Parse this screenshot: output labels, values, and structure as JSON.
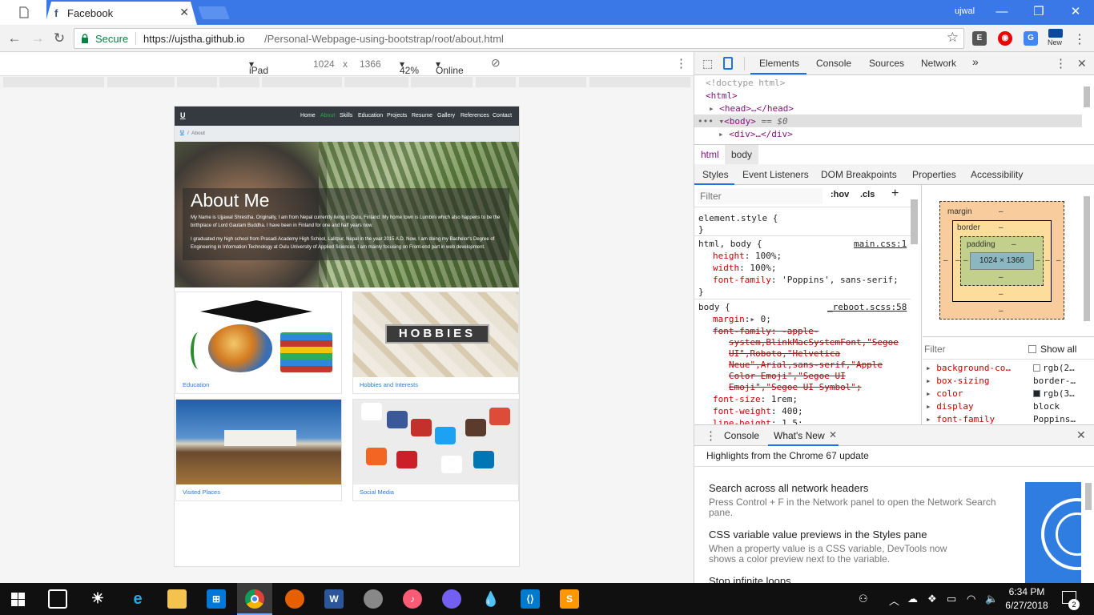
{
  "browser": {
    "tab_title": "Facebook",
    "user": "ujwal",
    "secure_label": "Secure",
    "url_host": "https://ujstha.github.io",
    "url_path": "/Personal-Webpage-using-bootstrap/root/about.html",
    "ext_new_label": "New"
  },
  "device_toolbar": {
    "device": "iPad Pro",
    "width": "1024",
    "times": "x",
    "height": "1366",
    "zoom": "42%",
    "network": "Online"
  },
  "site": {
    "brand": "U",
    "nav": [
      "Home",
      "About",
      "Skills",
      "Education",
      "Projects",
      "Resume",
      "Gallery",
      "References",
      "Contact"
    ],
    "active_nav": "About",
    "breadcrumb_home": "U",
    "breadcrumb_sep": "/",
    "breadcrumb_current": "About",
    "hero_title": "About Me",
    "hero_p1": "My Name is Ujjawal Shrestha. Originally, I am from Nepal currently living in Oulu, Finland. My home town is Lumbini which also happens to be the birthplace of Lord Gautam Buddha. I have been in Finland for one and half years now.",
    "hero_p2": "I graduated my high school from Prasadi Academy High School, Lalitpur, Nepal in the year 2015 A.D. Now, I am doing my Bachelor's Degree of Engineering in Information Technology at Oulu University of Applied Sciences. I am mainly focusing on Front-end part in web development.",
    "cards": [
      "Education",
      "Hobbies and Interests",
      "Visited Places",
      "Social Media"
    ],
    "hobbies_word": "HOBBIES"
  },
  "devtools": {
    "tabs": [
      "Elements",
      "Console",
      "Sources",
      "Network"
    ],
    "more_tabs": "»",
    "dom": {
      "doctype": "<!doctype html>",
      "html_open": "<html>",
      "head": "<head>…</head>",
      "body": "<body>",
      "body_eq": "== $0",
      "div": "<div>…</div>"
    },
    "path": [
      "html",
      "body"
    ],
    "subtabs": [
      "Styles",
      "Event Listeners",
      "DOM Breakpoints",
      "Properties",
      "Accessibility"
    ],
    "filter_placeholder": "Filter",
    "hov": ":hov",
    "cls": ".cls",
    "plus": "+",
    "rules": {
      "element_style": "element.style {",
      "close_brace": "}",
      "r1_selector": "html, body {",
      "r1_source": "main.css:1",
      "r1_props": [
        {
          "name": "height",
          "value": "100%;"
        },
        {
          "name": "width",
          "value": "100%;"
        },
        {
          "name": "font-family",
          "value": "'Poppins', sans-serif;"
        }
      ],
      "r2_selector": "body {",
      "r2_source": "_reboot.scss:58",
      "r2_margin_name": "margin",
      "r2_margin_value": "0;",
      "r2_struck": [
        "font-family: -apple-",
        "system,BlinkMacSystemFont,\"Segoe",
        "UI\",Roboto,\"Helvetica",
        "Neue\",Arial,sans-serif,\"Apple",
        "Color Emoji\",\"Segoe UI",
        "Emoji\",\"Segoe UI Symbol\";"
      ],
      "r2_props": [
        {
          "name": "font-size",
          "value": "1rem;"
        },
        {
          "name": "font-weight",
          "value": "400;"
        },
        {
          "name": "line-height",
          "value": "1.5;"
        }
      ]
    },
    "box_model": {
      "margin": "margin",
      "border": "border",
      "padding": "padding",
      "dash": "–",
      "content": "1024 × 1366"
    },
    "computed": {
      "filter_placeholder": "Filter",
      "show_all": "Show all",
      "rows": [
        {
          "name": "background-co…",
          "value": "rgb(2…",
          "swatch": "#ffffff"
        },
        {
          "name": "box-sizing",
          "value": "border-…",
          "swatch": ""
        },
        {
          "name": "color",
          "value": "rgb(3…",
          "swatch": "#212529"
        },
        {
          "name": "display",
          "value": "block",
          "swatch": ""
        },
        {
          "name": "font-family",
          "value": "Poppins…",
          "swatch": ""
        }
      ]
    },
    "drawer": {
      "tabs": [
        "Console",
        "What's New"
      ],
      "headline": "Highlights from the Chrome 67 update",
      "items": [
        {
          "title": "Search across all network headers",
          "desc": "Press Control + F in the Network panel to open the Network Search pane."
        },
        {
          "title": "CSS variable value previews in the Styles pane",
          "desc": "When a property value is a CSS variable, DevTools now shows a color preview next to the variable."
        },
        {
          "title": "Stop infinite loops",
          "desc": ""
        }
      ]
    }
  },
  "taskbar": {
    "time": "6:34 PM",
    "date": "6/27/2018",
    "notifications": "2"
  },
  "colors": {
    "chrome_blue": "#3b78e7",
    "link": "#2b7bd8",
    "navbar": "#343a40",
    "active_nav": "#28a745",
    "devtools_accent": "#1a73e8"
  }
}
